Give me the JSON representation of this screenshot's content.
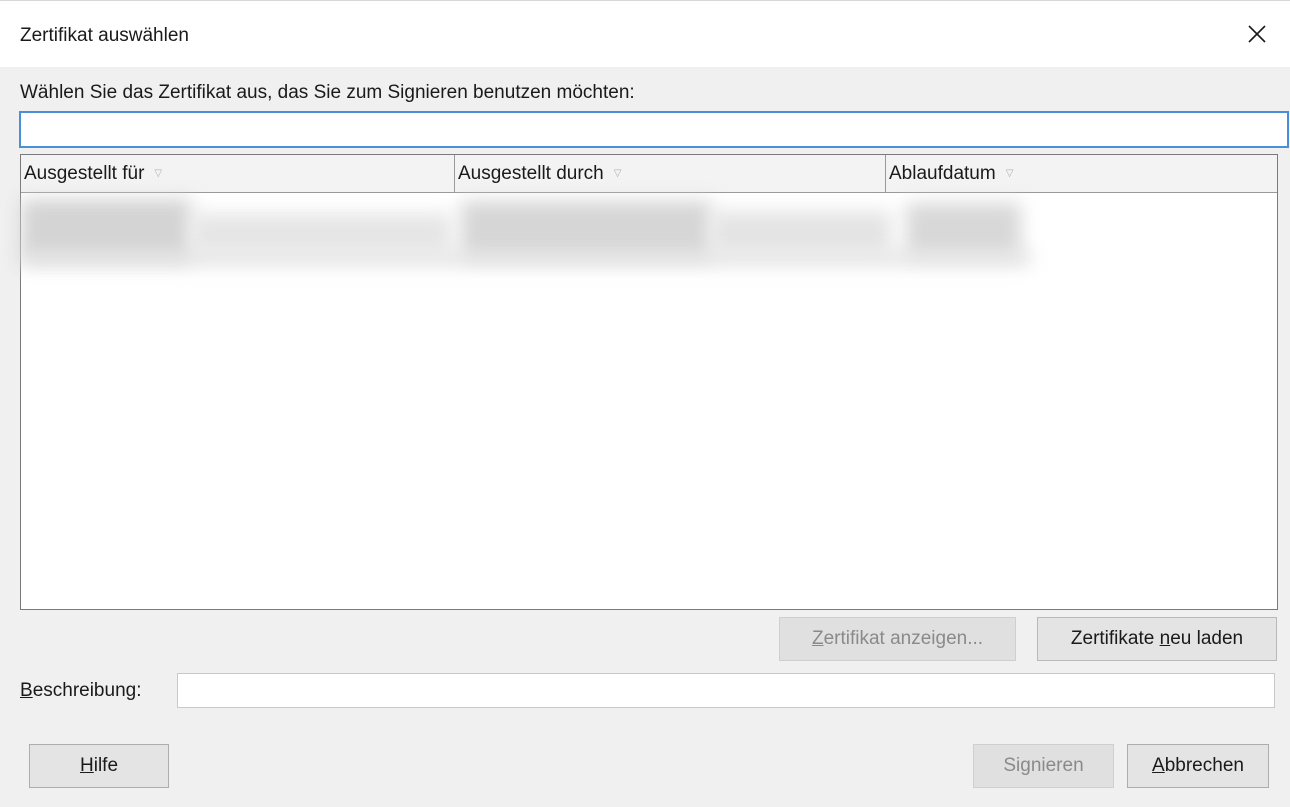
{
  "dialog": {
    "title": "Zertifikat auswählen",
    "prompt": "Wählen Sie das Zertifikat aus, das Sie zum Signieren benutzen möchten:",
    "search": {
      "value": "",
      "placeholder": ""
    }
  },
  "table": {
    "columns": [
      {
        "label": "Ausgestellt für"
      },
      {
        "label": "Ausgestellt durch"
      },
      {
        "label": "Ablaufdatum"
      }
    ],
    "rows": [
      {
        "issued_to": "",
        "issued_by": "",
        "expiry": ""
      }
    ]
  },
  "buttons": {
    "view_certificate": {
      "mnemonic": "Z",
      "rest": "ertifikat anzeigen...",
      "enabled": false
    },
    "reload_certificates": {
      "before": "Zertifikate ",
      "mnemonic": "n",
      "after": "eu laden",
      "enabled": true
    },
    "help": {
      "mnemonic": "H",
      "rest": "ilfe"
    },
    "sign": {
      "label": "Signieren",
      "enabled": false
    },
    "cancel": {
      "mnemonic": "A",
      "rest": "bbrechen"
    }
  },
  "description": {
    "label_mnemonic": "B",
    "label_rest": "eschreibung:",
    "value": ""
  },
  "icons": {
    "close": "close-icon",
    "sort": "sort-indicator-icon"
  },
  "colors": {
    "focus_border": "#4a90d9",
    "background": "#f0f0f0"
  }
}
